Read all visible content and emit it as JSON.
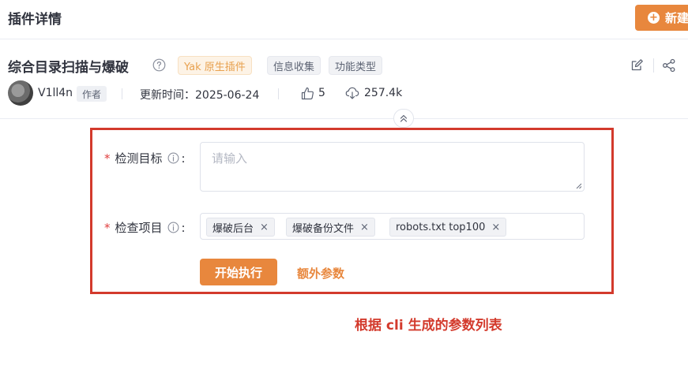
{
  "header": {
    "title": "插件详情",
    "new_button_label": "新建"
  },
  "plugin": {
    "name": "综合目录扫描与爆破",
    "tags": [
      "Yak 原生插件",
      "信息收集",
      "功能类型"
    ],
    "author": "V1ll4n",
    "author_tag": "作者",
    "update_time": "更新时间：2025-06-24",
    "likes": "5",
    "downloads": "257.4k"
  },
  "form": {
    "target_label": "检测目标",
    "target_placeholder": "请输入",
    "items_label": "检查项目",
    "colon": ":",
    "required_mark": "*",
    "selected_items": [
      "爆破后台",
      "爆破备份文件",
      "robots.txt top100"
    ],
    "chip_close": "×",
    "start_button_label": "开始执行",
    "extra_params_label": "额外参数"
  },
  "annotation": {
    "text": "根据 cli 生成的参数列表",
    "color": "#d33a2c"
  },
  "colors": {
    "accent": "#e8873d"
  }
}
